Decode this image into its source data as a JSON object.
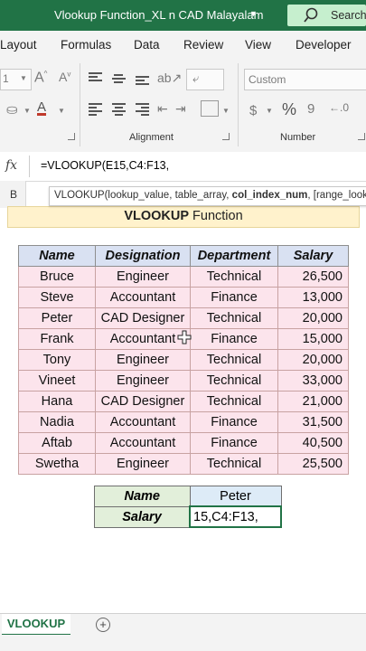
{
  "window": {
    "title": "Vlookup Function_XL n CAD Malayalam",
    "search_label": "Search"
  },
  "tabs": [
    "Layout",
    "Formulas",
    "Data",
    "Review",
    "View",
    "Developer"
  ],
  "ribbon": {
    "font_size_value": "1",
    "number_format_value": "Custom",
    "alignment_label": "Alignment",
    "number_label": "Number",
    "percent_symbol": "%"
  },
  "formula_bar": {
    "fx_label": "fx",
    "formula": "=VLOOKUP(E15,C4:F13,"
  },
  "column_header": "B",
  "tooltip": {
    "prefix": "VLOOKUP(lookup_value, table_array, ",
    "bold_arg": "col_index_num",
    "suffix": ", [range_looku"
  },
  "banner": {
    "bold": "VLOOKUP",
    "rest": " Function"
  },
  "table": {
    "headers": [
      "Name",
      "Designation",
      "Department",
      "Salary"
    ],
    "rows": [
      [
        "Bruce",
        "Engineer",
        "Technical",
        "26,500"
      ],
      [
        "Steve",
        "Accountant",
        "Finance",
        "13,000"
      ],
      [
        "Peter",
        "CAD Designer",
        "Technical",
        "20,000"
      ],
      [
        "Frank",
        "Accountant",
        "Finance",
        "15,000"
      ],
      [
        "Tony",
        "Engineer",
        "Technical",
        "20,000"
      ],
      [
        "Vineet",
        "Engineer",
        "Technical",
        "33,000"
      ],
      [
        "Hana",
        "CAD Designer",
        "Technical",
        "21,000"
      ],
      [
        "Nadia",
        "Accountant",
        "Finance",
        "31,500"
      ],
      [
        "Aftab",
        "Accountant",
        "Finance",
        "40,500"
      ],
      [
        "Swetha",
        "Engineer",
        "Technical",
        "25,500"
      ]
    ]
  },
  "lookup": {
    "name_label": "Name",
    "name_value": "Peter",
    "salary_label": "Salary",
    "salary_value": "15,C4:F13,"
  },
  "sheet_tab": "VLOOKUP",
  "add_sheet": "+",
  "colors": {
    "brand": "#217346",
    "header_fill": "#d9e1f2",
    "row_fill": "#fce4ec",
    "banner_fill": "#fff2cc"
  }
}
